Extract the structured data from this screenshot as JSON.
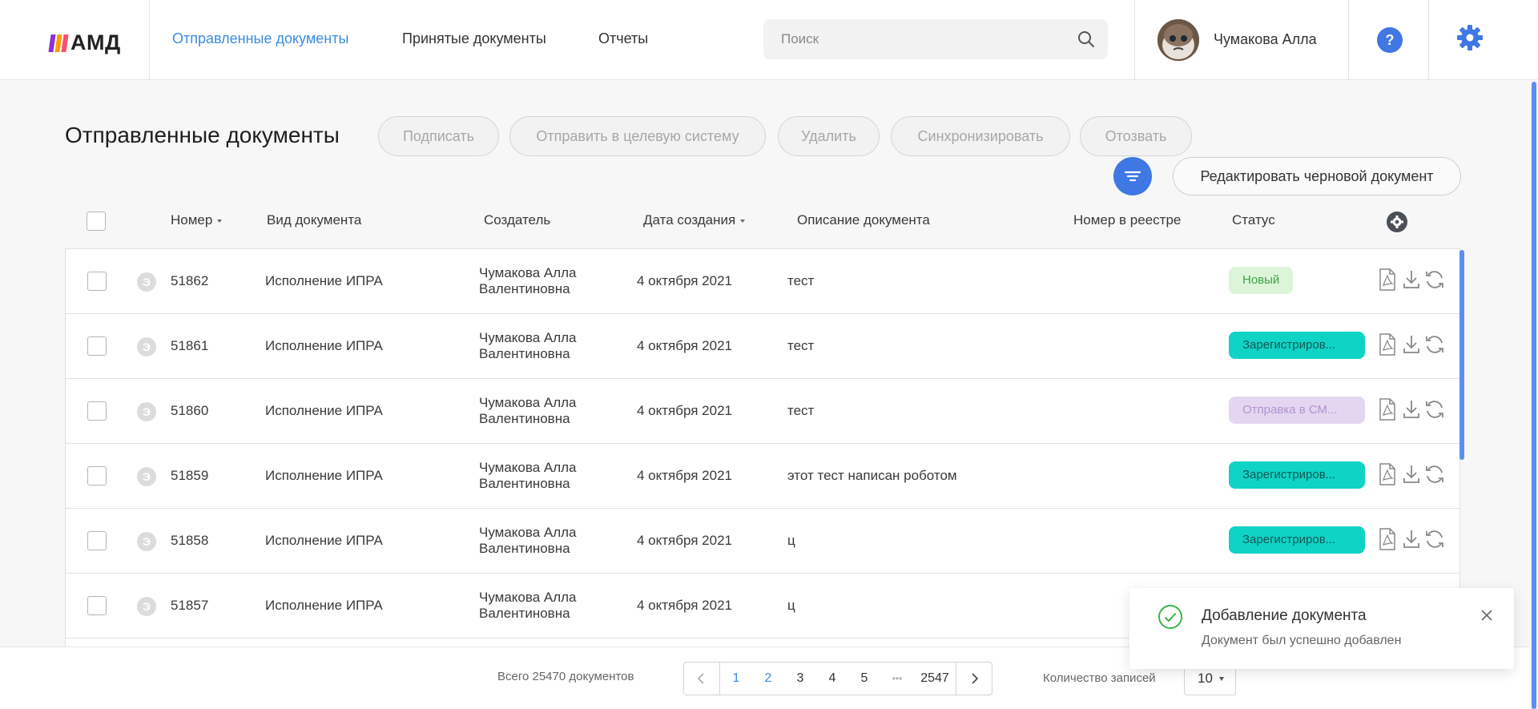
{
  "app": {
    "logo_text": "АМД",
    "logo_colors": [
      "#8f2fd6",
      "#ff9d00",
      "#ff4f70"
    ]
  },
  "nav": {
    "sent": "Отправленные документы",
    "received": "Принятые документы",
    "reports": "Отчеты"
  },
  "search": {
    "placeholder": "Поиск",
    "value": ""
  },
  "user": {
    "name": "Чумакова Алла"
  },
  "help": {
    "label": "?"
  },
  "page": {
    "title": "Отправленные документы"
  },
  "toolbar": {
    "sign": "Подписать",
    "send_target": "Отправить в целевую систему",
    "delete": "Удалить",
    "sync": "Синхронизировать",
    "revoke": "Отозвать",
    "edit_draft": "Редактировать черновой документ"
  },
  "table": {
    "headers": {
      "number": "Номер",
      "doc_type": "Вид документа",
      "creator": "Создатель",
      "created": "Дата создания",
      "description": "Описание документа",
      "registry": "Номер в реестре",
      "status": "Статус"
    },
    "rows": [
      {
        "badge": "Э",
        "number": "51862",
        "type": "Исполнение ИПРА",
        "creator_line1": "Чумакова Алла",
        "creator_line2": "Валентиновна",
        "date": "4 октября 2021",
        "description": "тест",
        "registry": "",
        "status": "Новый",
        "status_kind": "new"
      },
      {
        "badge": "Э",
        "number": "51861",
        "type": "Исполнение ИПРА",
        "creator_line1": "Чумакова Алла",
        "creator_line2": "Валентиновна",
        "date": "4 октября 2021",
        "description": "тест",
        "registry": "",
        "status": "Зарегистриров...",
        "status_kind": "registered"
      },
      {
        "badge": "Э",
        "number": "51860",
        "type": "Исполнение ИПРА",
        "creator_line1": "Чумакова Алла",
        "creator_line2": "Валентиновна",
        "date": "4 октября 2021",
        "description": "тест",
        "registry": "",
        "status": "Отправка в СМ...",
        "status_kind": "sending"
      },
      {
        "badge": "Э",
        "number": "51859",
        "type": "Исполнение ИПРА",
        "creator_line1": "Чумакова Алла",
        "creator_line2": "Валентиновна",
        "date": "4 октября 2021",
        "description": "этот тест написан роботом",
        "registry": "",
        "status": "Зарегистриров...",
        "status_kind": "registered"
      },
      {
        "badge": "Э",
        "number": "51858",
        "type": "Исполнение ИПРА",
        "creator_line1": "Чумакова Алла",
        "creator_line2": "Валентиновна",
        "date": "4 октября 2021",
        "description": "ц",
        "registry": "",
        "status": "Зарегистриров...",
        "status_kind": "registered"
      },
      {
        "badge": "Э",
        "number": "51857",
        "type": "Исполнение ИПРА",
        "creator_line1": "Чумакова Алла",
        "creator_line2": "Валентиновна",
        "date": "4 октября 2021",
        "description": "ц",
        "registry": "",
        "status": "",
        "status_kind": ""
      }
    ],
    "status_colors": {
      "new": {
        "bg": "#dcf5d8",
        "fg": "#3fa046"
      },
      "registered": {
        "bg": "#0fd3c4",
        "fg": "#0e5a55"
      },
      "sending": {
        "bg": "#e4d6f0",
        "fg": "#b393d0"
      }
    }
  },
  "footer": {
    "total": "Всего 25470 документов",
    "pages": [
      "1",
      "2",
      "3",
      "4",
      "5"
    ],
    "current_page": "1",
    "ellipsis": "•••",
    "last_page": "2547",
    "records_label": "Количество записей",
    "records_value": "10"
  },
  "toast": {
    "title": "Добавление документа",
    "message": "Документ был успешно добавлен"
  },
  "colors": {
    "accent": "#3c8bdf",
    "primary": "#3f77e4",
    "success": "#3bb54a"
  }
}
